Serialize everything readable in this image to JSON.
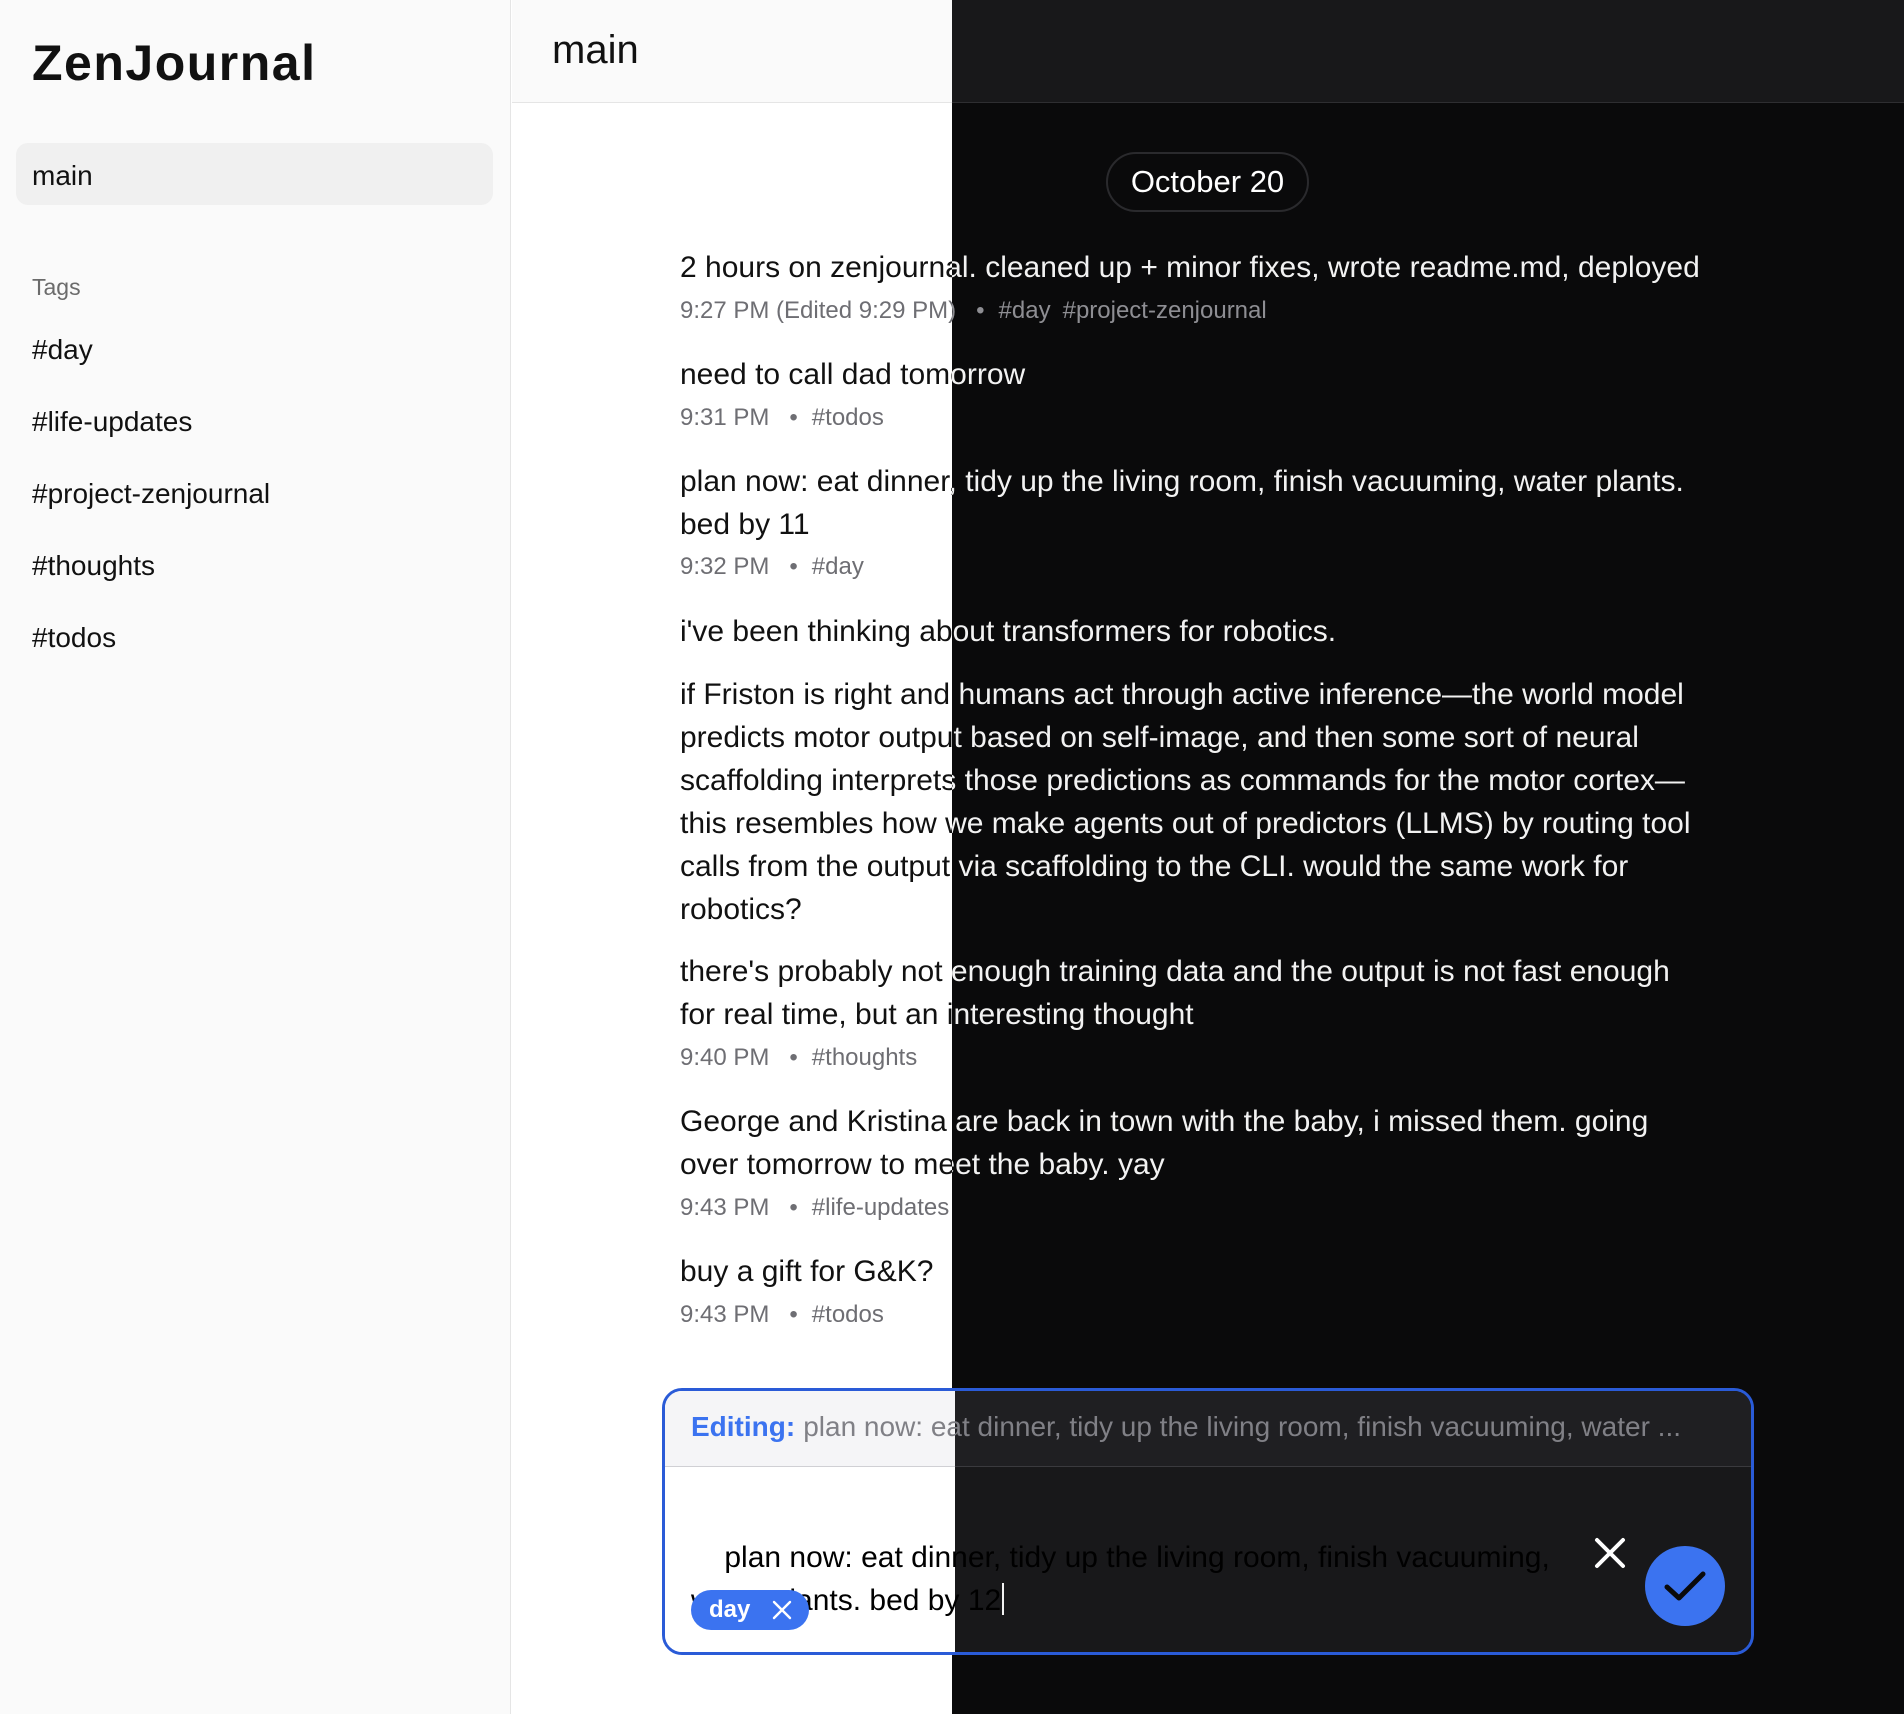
{
  "app": {
    "title": "ZenJournal"
  },
  "sidebar": {
    "main_label": "main",
    "tags_heading": "Tags",
    "tags": [
      "#day",
      "#life-updates",
      "#project-zenjournal",
      "#thoughts",
      "#todos"
    ]
  },
  "header": {
    "title": "main"
  },
  "feed": {
    "date": "October 20",
    "entries": [
      {
        "text": "2 hours on zenjournal. cleaned up + minor fixes, wrote readme.md, deployed",
        "time": "9:27 PM (Edited 9:29 PM)",
        "tags": [
          "#day",
          "#project-zenjournal"
        ]
      },
      {
        "text": "need to call dad tomorrow",
        "time": "9:31 PM",
        "tags": [
          "#todos"
        ]
      },
      {
        "text": "plan now: eat dinner, tidy up the living room, finish vacuuming, water plants.\nbed by 11",
        "time": "9:32 PM",
        "tags": [
          "#day"
        ]
      },
      {
        "paragraphs": [
          "i've been thinking about transformers for robotics.",
          "if Friston is right and humans act through active inference—the world model\npredicts motor output based on self-image, and then some sort of neural\nscaffolding interprets those predictions as commands for the motor cortex—\nthis resembles how we make agents out of predictors (LLMS) by routing tool\ncalls from the output via scaffolding to the CLI. would the same work for\nrobotics?",
          "there's probably not enough training data and the output is not fast enough\nfor real time, but an interesting thought"
        ],
        "time": "9:40 PM",
        "tags": [
          "#thoughts"
        ]
      },
      {
        "text": "George and Kristina are back in town with the baby, i missed them. going\nover tomorrow to meet the baby. yay",
        "time": "9:43 PM",
        "tags": [
          "#life-updates"
        ]
      },
      {
        "text": "buy a gift for G&K?",
        "time": "9:43 PM",
        "tags": [
          "#todos"
        ]
      }
    ],
    "separator": "•"
  },
  "editor": {
    "label": "Editing:",
    "preview": "plan now: eat dinner, tidy up the living room, finish vacuuming, water ...",
    "text": "plan now: eat dinner, tidy up the living room, finish vacuuming,\nwater plants. bed by 12",
    "chip": "day",
    "cancel_icon": "close-icon",
    "confirm_icon": "check-icon"
  },
  "colors": {
    "accent": "#3b73f0",
    "editor_border": "#2a5bd7",
    "dark_bg": "#0a0a0b",
    "sidebar_bg": "#fafafa"
  }
}
